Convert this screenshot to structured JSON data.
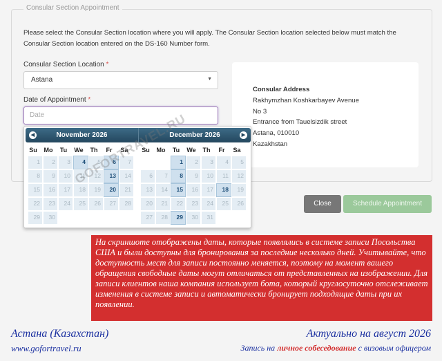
{
  "form": {
    "legend": "Consular Section Appointment",
    "instructions": "Please select the Consular Section location where you will apply. The Consular Section location selected below must match the Consular Section location entered on the DS-160 Number form.",
    "location_label": "Consular Section Location",
    "location_value": "Astana",
    "date_label": "Date of Appointment",
    "date_placeholder": "Date",
    "required_mark": "*"
  },
  "address": {
    "title": "Consular Address",
    "lines": [
      "Rakhymzhan Koshkarbayev Avenue",
      "No 3",
      "Entrance from Tauelsizdik street",
      "Astana, 010010",
      "Kazakhstan"
    ]
  },
  "calendar": {
    "weekdays": [
      "Su",
      "Mo",
      "Tu",
      "We",
      "Th",
      "Fr",
      "Sa"
    ],
    "months": [
      {
        "title": "November 2026",
        "offset": 0,
        "days": 30,
        "available": [
          4,
          6,
          13,
          20
        ]
      },
      {
        "title": "December 2026",
        "offset": 2,
        "days": 31,
        "available": [
          1,
          8,
          15,
          18,
          29
        ]
      }
    ],
    "prev_icon": "chevron-left-icon",
    "next_icon": "chevron-right-icon"
  },
  "buttons": {
    "close": "Close",
    "schedule": "Schedule Appointment"
  },
  "watermark": "GOFORTRAVEL.RU",
  "notice": "На скриншоте отображены даты, которые появлялись в системе записи Посольства США и были доступны для бронирования за последние несколько дней. Учитывайте, что доступность мест для записи постоянно меняется, поэтому на момент вашего обращения свободные даты могут отличаться от представленных на изображении. Для записи клиентов наша компания использует бота, который круглосуточно отслеживает изменения в системе записи и автоматически бронирует подходящие даты при их появлении.",
  "footer": {
    "city": "Астана (Казахстан)",
    "site": "www.gofortravel.ru",
    "date": "Актуально на август 2026",
    "note_pre": "Запись на",
    "note_em": "личное собеседование",
    "note_post": "с визовым офицером"
  },
  "colors": {
    "accent": "#24475e",
    "notice_bg": "#d32f2f",
    "footer_text": "#1a2fa0",
    "schedule_btn": "#9bc99b"
  }
}
